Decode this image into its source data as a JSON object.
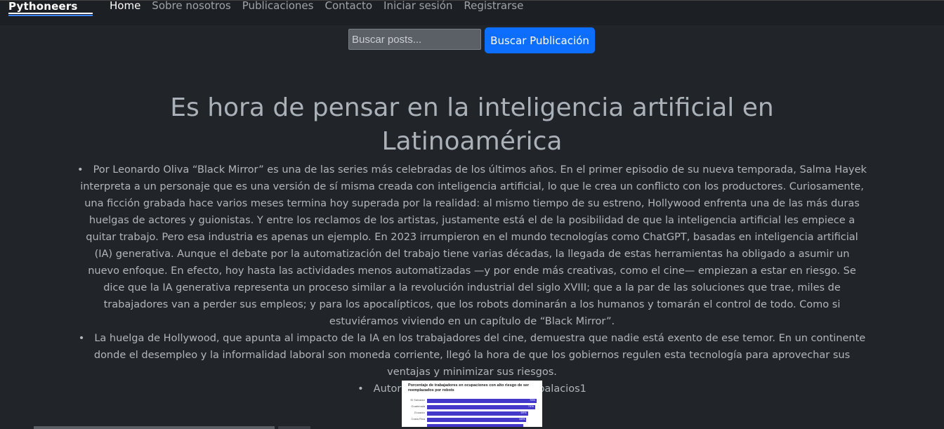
{
  "navbar": {
    "brand": "Pythoneers",
    "links": [
      {
        "label": "Home",
        "active": true
      },
      {
        "label": "Sobre nosotros"
      },
      {
        "label": "Publicaciones"
      },
      {
        "label": "Contacto"
      },
      {
        "label": "Iniciar sesión"
      },
      {
        "label": "Registrarse"
      }
    ]
  },
  "search": {
    "placeholder": "Buscar posts...",
    "value": "",
    "button_label": "Buscar Publicación"
  },
  "post": {
    "title": "Es hora de pensar en la inteligencia artificial en Latinoamérica",
    "paragraphs": [
      "Por Leonardo Oliva “Black Mirror” es una de las series más celebradas de los últimos años. En el primer episodio de su nueva temporada, Salma Hayek interpreta a un personaje que es una versión de sí misma creada con inteligencia artificial, lo que le crea un conflicto con los productores. Curiosamente, una ficción grabada hace varios meses termina hoy superada por la realidad: al mismo tiempo de su estreno, Hollywood enfrenta una de las más duras huelgas de actores y guionistas. Y entre los reclamos de los artistas, justamente está el de la posibilidad de que la inteligencia artificial les empiece a quitar trabajo. Pero esa industria es apenas un ejemplo. En 2023 irrumpieron en el mundo tecnologías como ChatGPT, basadas en inteligencia artificial (IA) generativa. Aunque el debate por la automatización del trabajo tiene varias décadas, la llegada de estas herramientas ha obligado a asumir un nuevo enfoque. En efecto, hoy hasta las actividades menos automatizadas —y por ende más creativas, como el cine— empiezan a estar en riesgo. Se dice que la IA generativa representa un proceso similar a la revolución industrial del siglo XVIII; que a la par de las soluciones que trae, miles de trabajadores van a perder sus empleos; y para los apocalípticos, que los robots dominarán a los humanos y tomarán el control de todo. Como si estuviéramos viviendo en un capítulo de “Black Mirror”.",
      "La huelga de Hollywood, que apunta al impacto de la IA en los trabajadores del cine, demuestra que nadie está exento de ese temor. En un continente donde el desempleo y la informalidad laboral son moneda corriente, llegó la hora de que los gobiernos regulen esta tecnología para aprovechar sus ventajas y minimizar sus riesgos."
    ],
    "author_line": "Autor de la publicación: gustavopalacios1",
    "image": {
      "title": "Porcentaje de trabajadores en ocupaciones con alto riesgo de ser reemplazados por robots",
      "rows": [
        {
          "label": "El Salvador",
          "value": "75%",
          "pct": 0.75
        },
        {
          "label": "Guatemala",
          "value": "74%",
          "pct": 0.74
        },
        {
          "label": "Ecuador",
          "value": "69%",
          "pct": 0.69
        },
        {
          "label": "Costa Rica",
          "value": "68%",
          "pct": 0.68
        },
        {
          "label": "",
          "value": "",
          "pct": 0.66
        }
      ],
      "bar_color": "#4338ca"
    }
  },
  "colors": {
    "background": "#212529",
    "navbar": "#1c1f23",
    "accent": "#0d6efd"
  }
}
